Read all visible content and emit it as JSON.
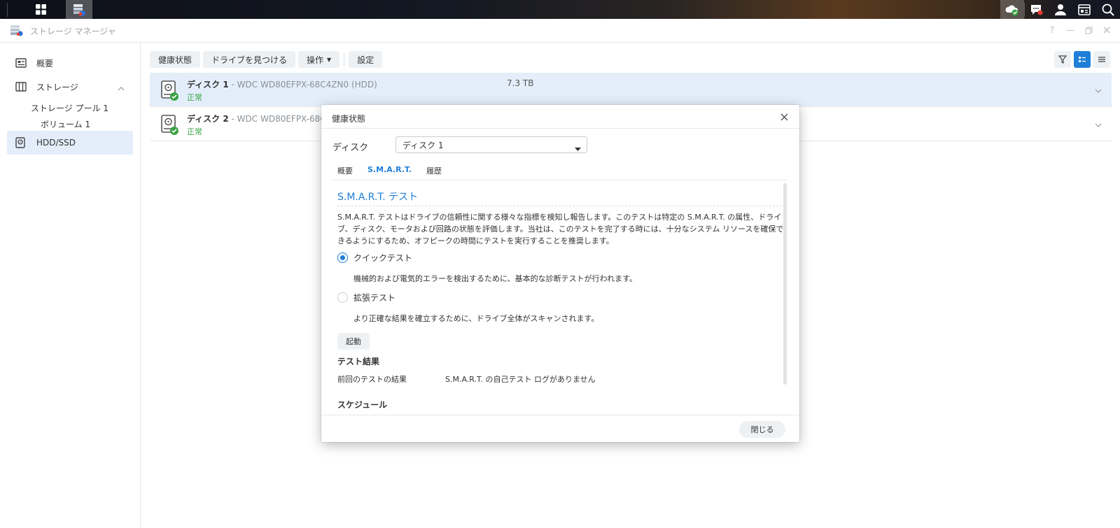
{
  "window": {
    "title": "ストレージ マネージャ"
  },
  "sidebar": {
    "items": [
      {
        "label": "概要",
        "icon": "overview-icon"
      },
      {
        "label": "ストレージ",
        "icon": "storage-icon"
      },
      {
        "label": "ストレージ プール 1"
      },
      {
        "label": "ボリューム 1"
      },
      {
        "label": "HDD/SSD",
        "icon": "hdd-icon"
      }
    ]
  },
  "toolbar": {
    "health": "健康状態",
    "locate": "ドライブを見つける",
    "action": "操作",
    "settings": "設定"
  },
  "disks": [
    {
      "name": "ディスク 1",
      "model": " - WDC WD80EFPX-68C4ZN0 (HDD)",
      "status": "正常",
      "size": "7.3 TB"
    },
    {
      "name": "ディスク 2",
      "model": " - WDC WD80EFPX-68C4",
      "status": "正常",
      "size": ""
    }
  ],
  "dialog": {
    "title": "健康状態",
    "disk_label": "ディスク",
    "disk_selected": "ディスク 1",
    "tabs": [
      "概要",
      "S.M.A.R.T.",
      "履歴"
    ],
    "active_tab": "S.M.A.R.T.",
    "section_title": "S.M.A.R.T. テスト",
    "description": "S.M.A.R.T. テストはドライブの信頼性に関する様々な指標を検知し報告します。このテストは特定の S.M.A.R.T. の属性、ドライブ、ディスク、モータおよび回路の状態を評価します。当社は、このテストを完了する時には、十分なシステム リソースを確保できるようにするため、オフピークの時間にテストを実行することを推奨します。",
    "quick_test_label": "クイックテスト",
    "quick_test_desc": "機械的および電気的エラーを検出するために、基本的な診断テストが行われます。",
    "extended_test_label": "拡張テスト",
    "extended_test_desc": "より正確な結果を確立するために、ドライブ全体がスキャンされます。",
    "start_label": "起動",
    "results_title": "テスト結果",
    "last_result_label": "前回のテストの結果",
    "last_result_value": "S.M.A.R.T. の自己テスト ログがありません",
    "schedule_title": "スケジュール",
    "close_label": "閉じる"
  },
  "colors": {
    "accent": "#1f7fd8",
    "ok": "#3aa343",
    "selected_row": "#e3eefa"
  }
}
